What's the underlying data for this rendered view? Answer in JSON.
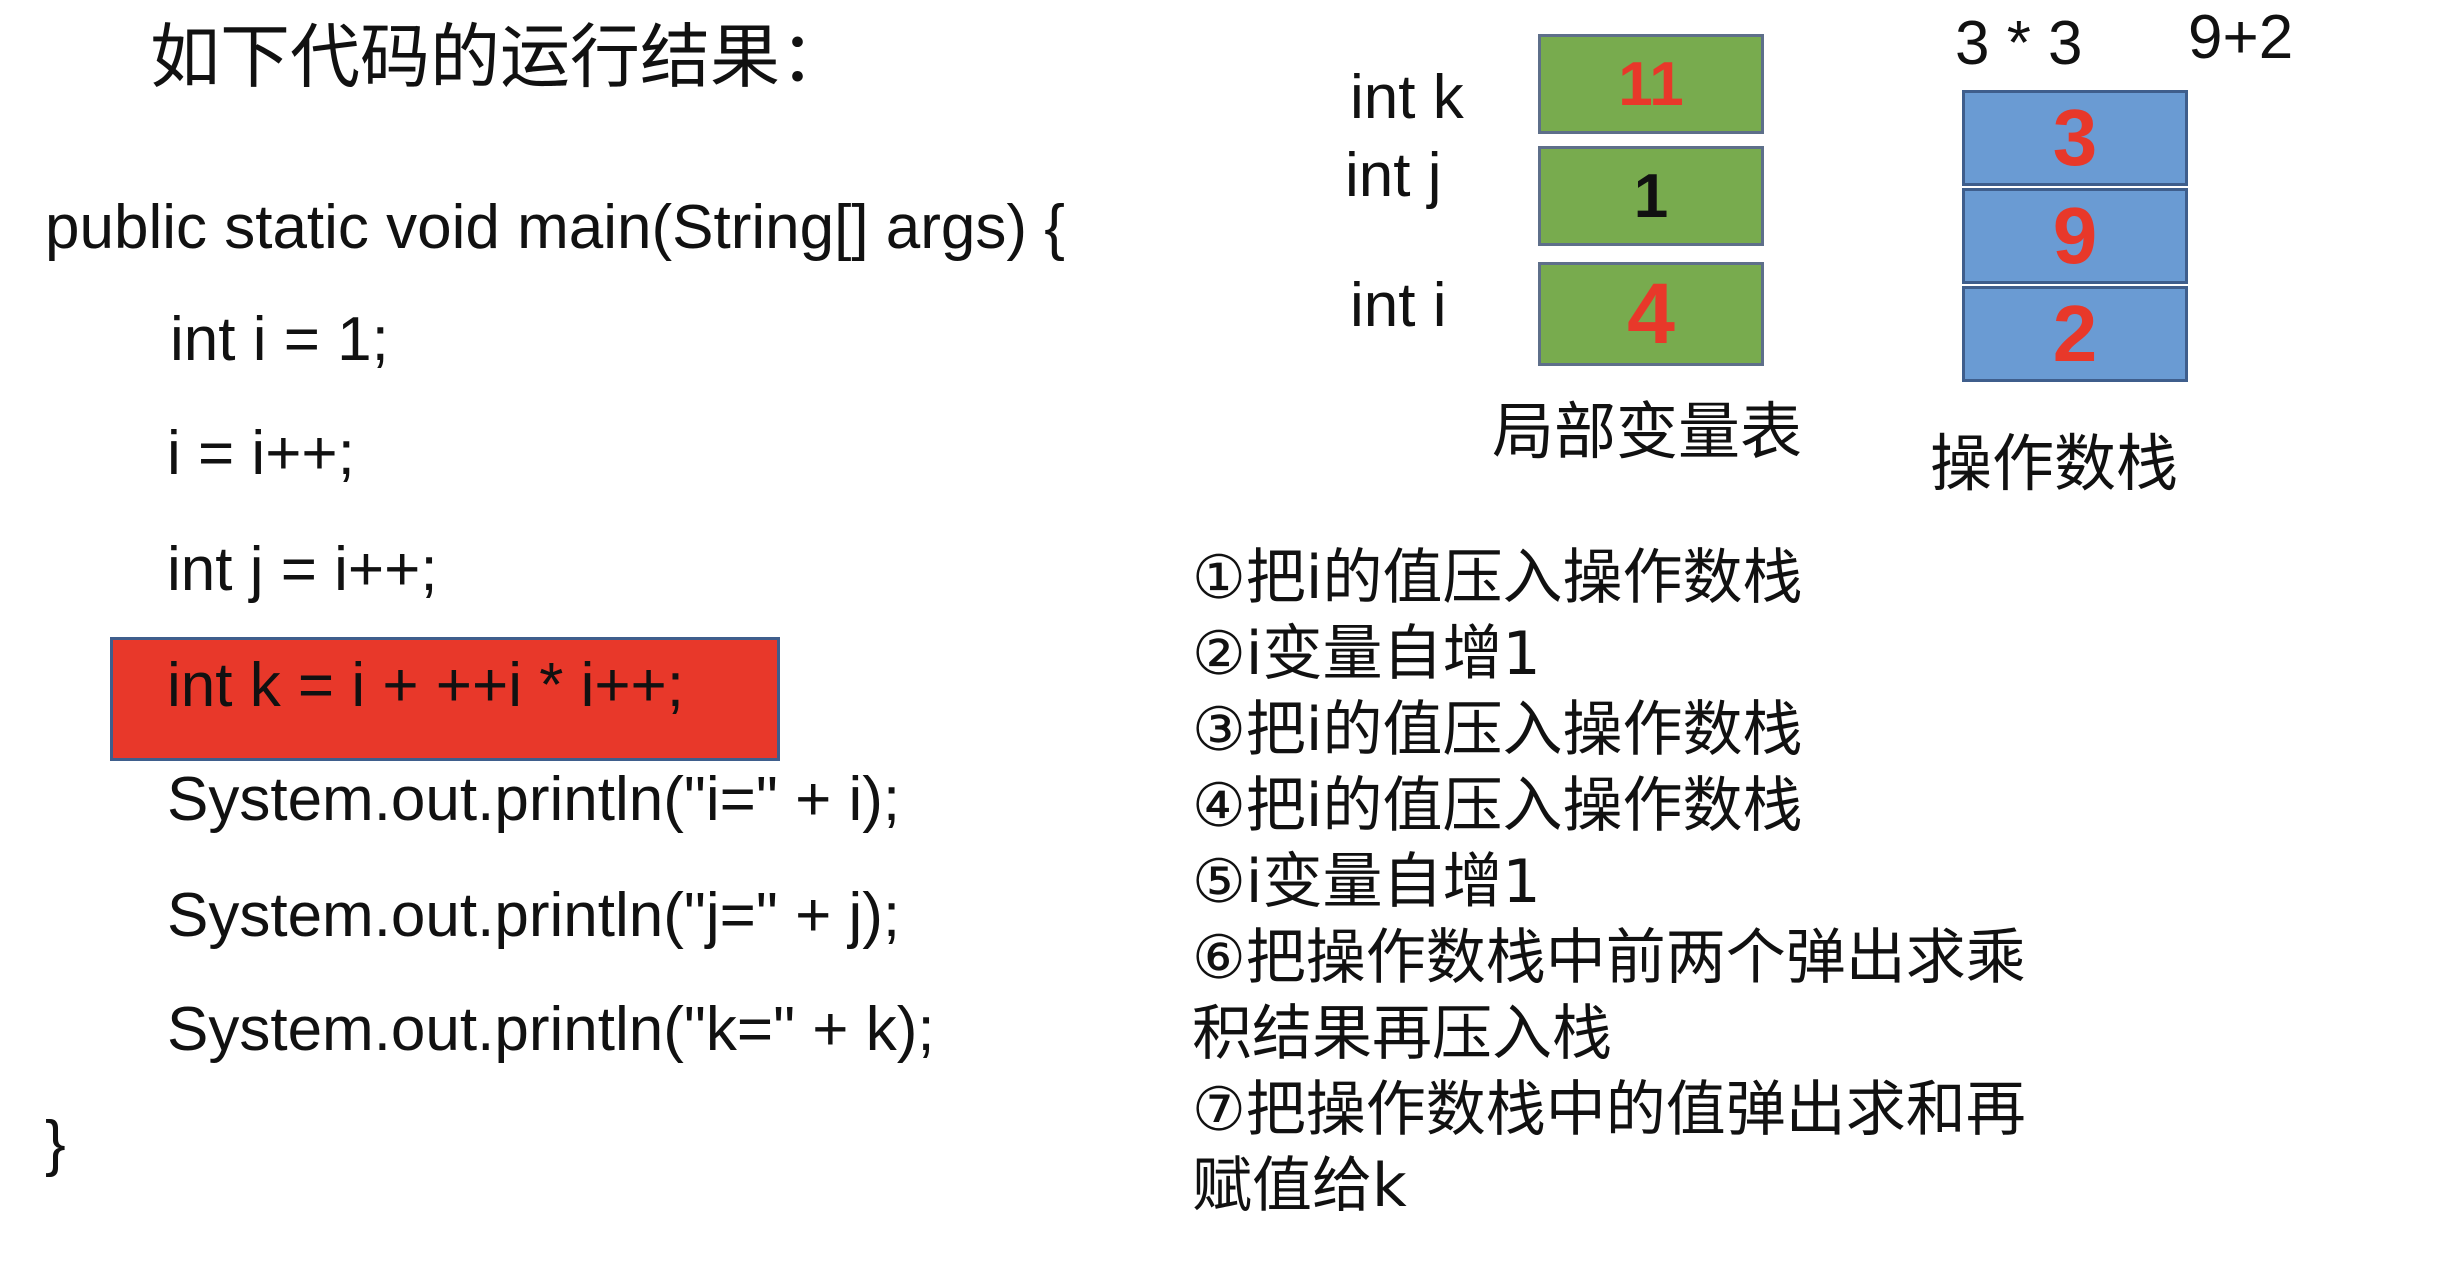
{
  "title": "如下代码的运行结果：",
  "code": {
    "line1": "public static void main(String[] args) {",
    "line2": "int i = 1;",
    "line3": "i = i++;",
    "line4": "int j = i++;",
    "line5": "int k = i + ++i * i++;",
    "line6": "System.out.println(\"i=\" + i);",
    "line7": "System.out.println(\"j=\" + j);",
    "line8": "System.out.println(\"k=\" + k);",
    "line9": "}"
  },
  "local_vars": {
    "label_k": "int  k",
    "label_j": "int   j",
    "label_i": "int  i",
    "value_k": "11",
    "value_j": "1",
    "value_i": "4",
    "caption": "局部变量表"
  },
  "operand_stack": {
    "note_left": "3 * 3",
    "note_right": "9+2",
    "values": [
      "3",
      "9",
      "2"
    ],
    "caption": "操作数栈"
  },
  "steps": [
    "①把i的值压入操作数栈",
    "②i变量自增1",
    "③把i的值压入操作数栈",
    "④把i的值压入操作数栈",
    "⑤i变量自增1",
    "⑥把操作数栈中前两个弹出求乘",
    "积结果再压入栈",
    "⑦把操作数栈中的值弹出求和再",
    "赋值给k"
  ],
  "colors": {
    "highlight": "#e8382a",
    "local_var_cell": "#78ab4e",
    "stack_cell": "#6a9bd3",
    "value_red": "#e8382a"
  }
}
